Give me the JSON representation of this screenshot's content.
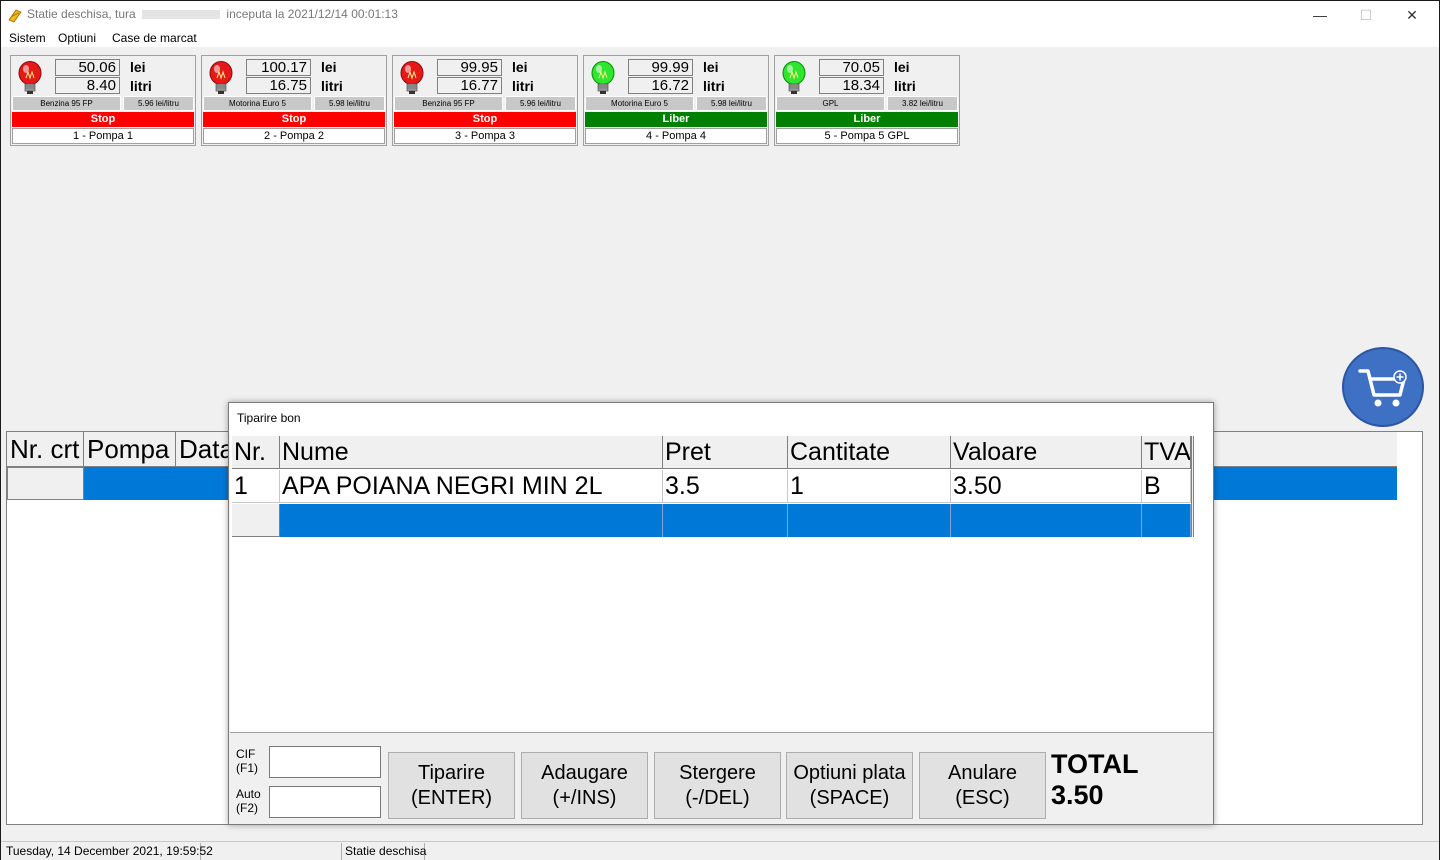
{
  "window": {
    "title_prefix": "Statie deschisa, tura",
    "title_suffix": "inceputa la 2021/12/14 00:01:13",
    "min_label": "—",
    "max_label": "☐",
    "close_label": "✕"
  },
  "menu": [
    "Sistem",
    "Optiuni",
    "Case de marcat"
  ],
  "pumps": [
    {
      "value": "50.06",
      "liters": "8.40",
      "lei": "lei",
      "litri": "litri",
      "fuel": "Benzina 95 FP",
      "price": "5.96 lei/litru",
      "status": "Stop",
      "name": "1 - Pompa 1",
      "status_color": "#ff0000",
      "light": "red"
    },
    {
      "value": "100.17",
      "liters": "16.75",
      "lei": "lei",
      "litri": "litri",
      "fuel": "Motorina Euro 5",
      "price": "5.98 lei/litru",
      "status": "Stop",
      "name": "2 - Pompa 2",
      "status_color": "#ff0000",
      "light": "red"
    },
    {
      "value": "99.95",
      "liters": "16.77",
      "lei": "lei",
      "litri": "litri",
      "fuel": "Benzina 95 FP",
      "price": "5.96 lei/litru",
      "status": "Stop",
      "name": "3 - Pompa 3",
      "status_color": "#ff0000",
      "light": "red"
    },
    {
      "value": "99.99",
      "liters": "16.72",
      "lei": "lei",
      "litri": "litri",
      "fuel": "Motorina Euro 5",
      "price": "5.98 lei/litru",
      "status": "Liber",
      "name": "4 - Pompa 4",
      "status_color": "#008000",
      "light": "green"
    },
    {
      "value": "70.05",
      "liters": "18.34",
      "lei": "lei",
      "litri": "litri",
      "fuel": "GPL",
      "price": "3.82 lei/litru",
      "status": "Liber",
      "name": "5 - Pompa 5 GPL",
      "status_color": "#008000",
      "light": "green"
    }
  ],
  "background_grid": {
    "columns": [
      "Nr. crt",
      "Pompa",
      "Data"
    ]
  },
  "dialog": {
    "title": "Tiparire bon",
    "columns": [
      "Nr.",
      "Nume",
      "Pret",
      "Cantitate",
      "Valoare",
      "TVA"
    ],
    "rows": [
      [
        "1",
        "APA POIANA NEGRI MIN 2L",
        "3.5",
        "1",
        "3.50",
        "B"
      ]
    ],
    "cif_label": "CIF (F1)",
    "auto_label": "Auto (F2)",
    "cif_value": "",
    "auto_value": "",
    "buttons": [
      {
        "line1": "Tiparire",
        "line2": "(ENTER)"
      },
      {
        "line1": "Adaugare",
        "line2": "(+/INS)"
      },
      {
        "line1": "Stergere",
        "line2": "(-/DEL)"
      },
      {
        "line1": "Optiuni plata",
        "line2": "(SPACE)"
      },
      {
        "line1": "Anulare",
        "line2": "(ESC)"
      }
    ],
    "total_label": "TOTAL",
    "total_value": "3.50"
  },
  "statusbar": {
    "date": "Tuesday, 14 December 2021, 19:59:52",
    "status": "Statie deschisa"
  },
  "colors": {
    "selection": "#0078d7",
    "stop": "#ff0000",
    "free": "#008000",
    "cart": "#3e71c4"
  }
}
